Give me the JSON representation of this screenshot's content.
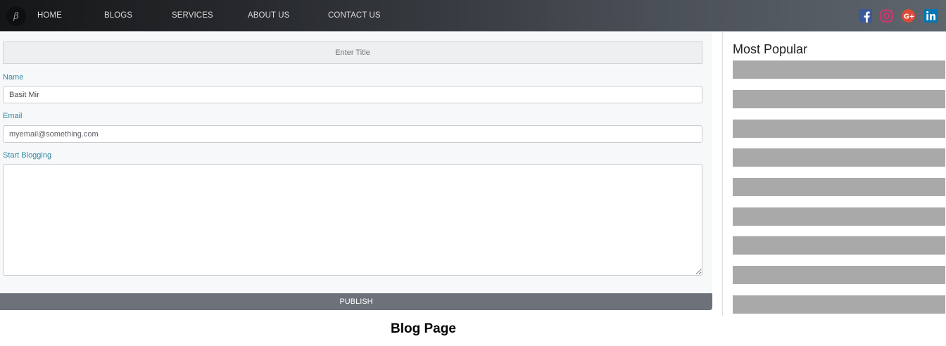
{
  "navbar": {
    "logo_glyph": "β",
    "links": [
      "HOME",
      "BLOGS",
      "SERVICES",
      "ABOUT US",
      "CONTACT US"
    ],
    "social": [
      {
        "icon": "facebook-icon",
        "color": "#3b5998"
      },
      {
        "icon": "instagram-icon",
        "color": "#e1306c"
      },
      {
        "icon": "google-plus-icon",
        "color": "#dd4b39"
      },
      {
        "icon": "linkedin-icon",
        "color": "#0077b5"
      }
    ]
  },
  "form": {
    "title_placeholder": "Enter Title",
    "name_label": "Name",
    "name_value": "Basit Mir",
    "email_label": "Email",
    "email_placeholder": "myemail@something.com",
    "blog_label": "Start Blogging",
    "blog_value": "",
    "publish_label": "PUBLISH"
  },
  "sidebar": {
    "title": "Most Popular",
    "items": [
      "",
      "",
      "",
      "",
      "",
      "",
      "",
      "",
      ""
    ]
  },
  "caption": "Blog Page",
  "colors": {
    "label_accent": "#2f8aa3",
    "publish_button": "#6c717a",
    "popular_placeholder": "#a9a9a9"
  }
}
